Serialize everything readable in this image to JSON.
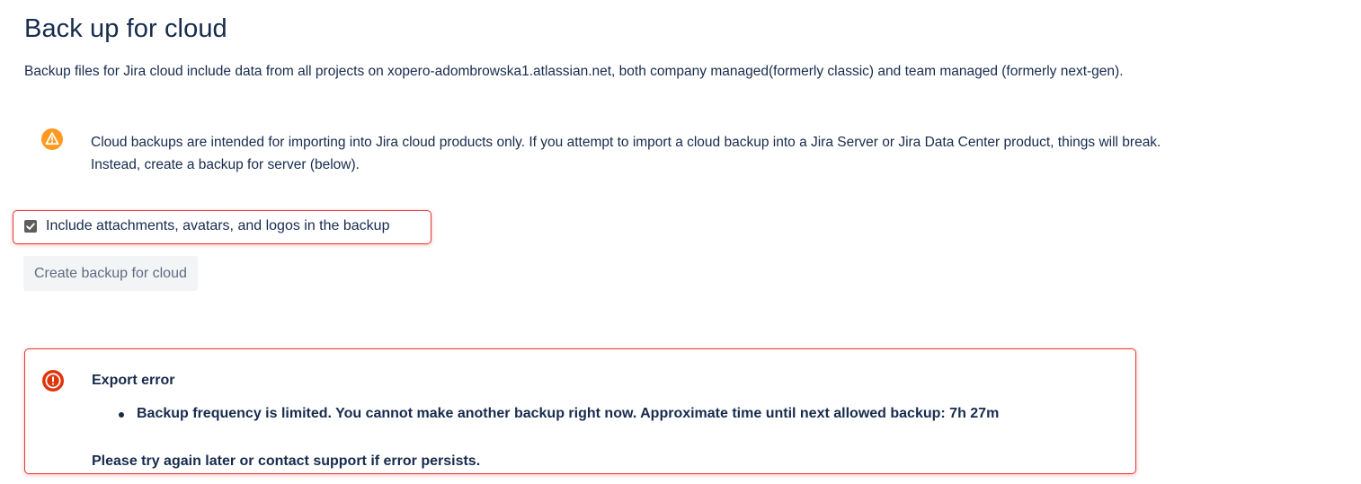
{
  "page": {
    "title": "Back up for cloud",
    "description": "Backup files for Jira cloud include data from all projects on xopero-adombrowska1.atlassian.net, both company managed(formerly classic) and team managed (formerly next-gen)."
  },
  "warning": {
    "icon": "warning-icon",
    "color": "#ff991f",
    "line1": "Cloud backups are intended for importing into Jira cloud products only. If you attempt to import a cloud backup into a Jira Server or Jira Data Center product, things will break.",
    "line2": "Instead, create a backup for server (below)."
  },
  "options": {
    "include_attachments_label": "Include attachments, avatars, and logos in the backup",
    "include_attachments_checked": true
  },
  "actions": {
    "create_backup_label": "Create backup for cloud",
    "create_backup_disabled": true
  },
  "error": {
    "icon": "error-icon",
    "color": "#de350b",
    "title": "Export error",
    "items": [
      "Backup frequency is limited. You cannot make another backup right now. Approximate time until next allowed backup: 7h 27m"
    ],
    "footer": "Please try again later or contact support if error persists."
  },
  "colors": {
    "text": "#172b4d",
    "highlight_border": "#e53935",
    "button_bg": "#f3f4f5",
    "button_text": "#5e6c84"
  }
}
